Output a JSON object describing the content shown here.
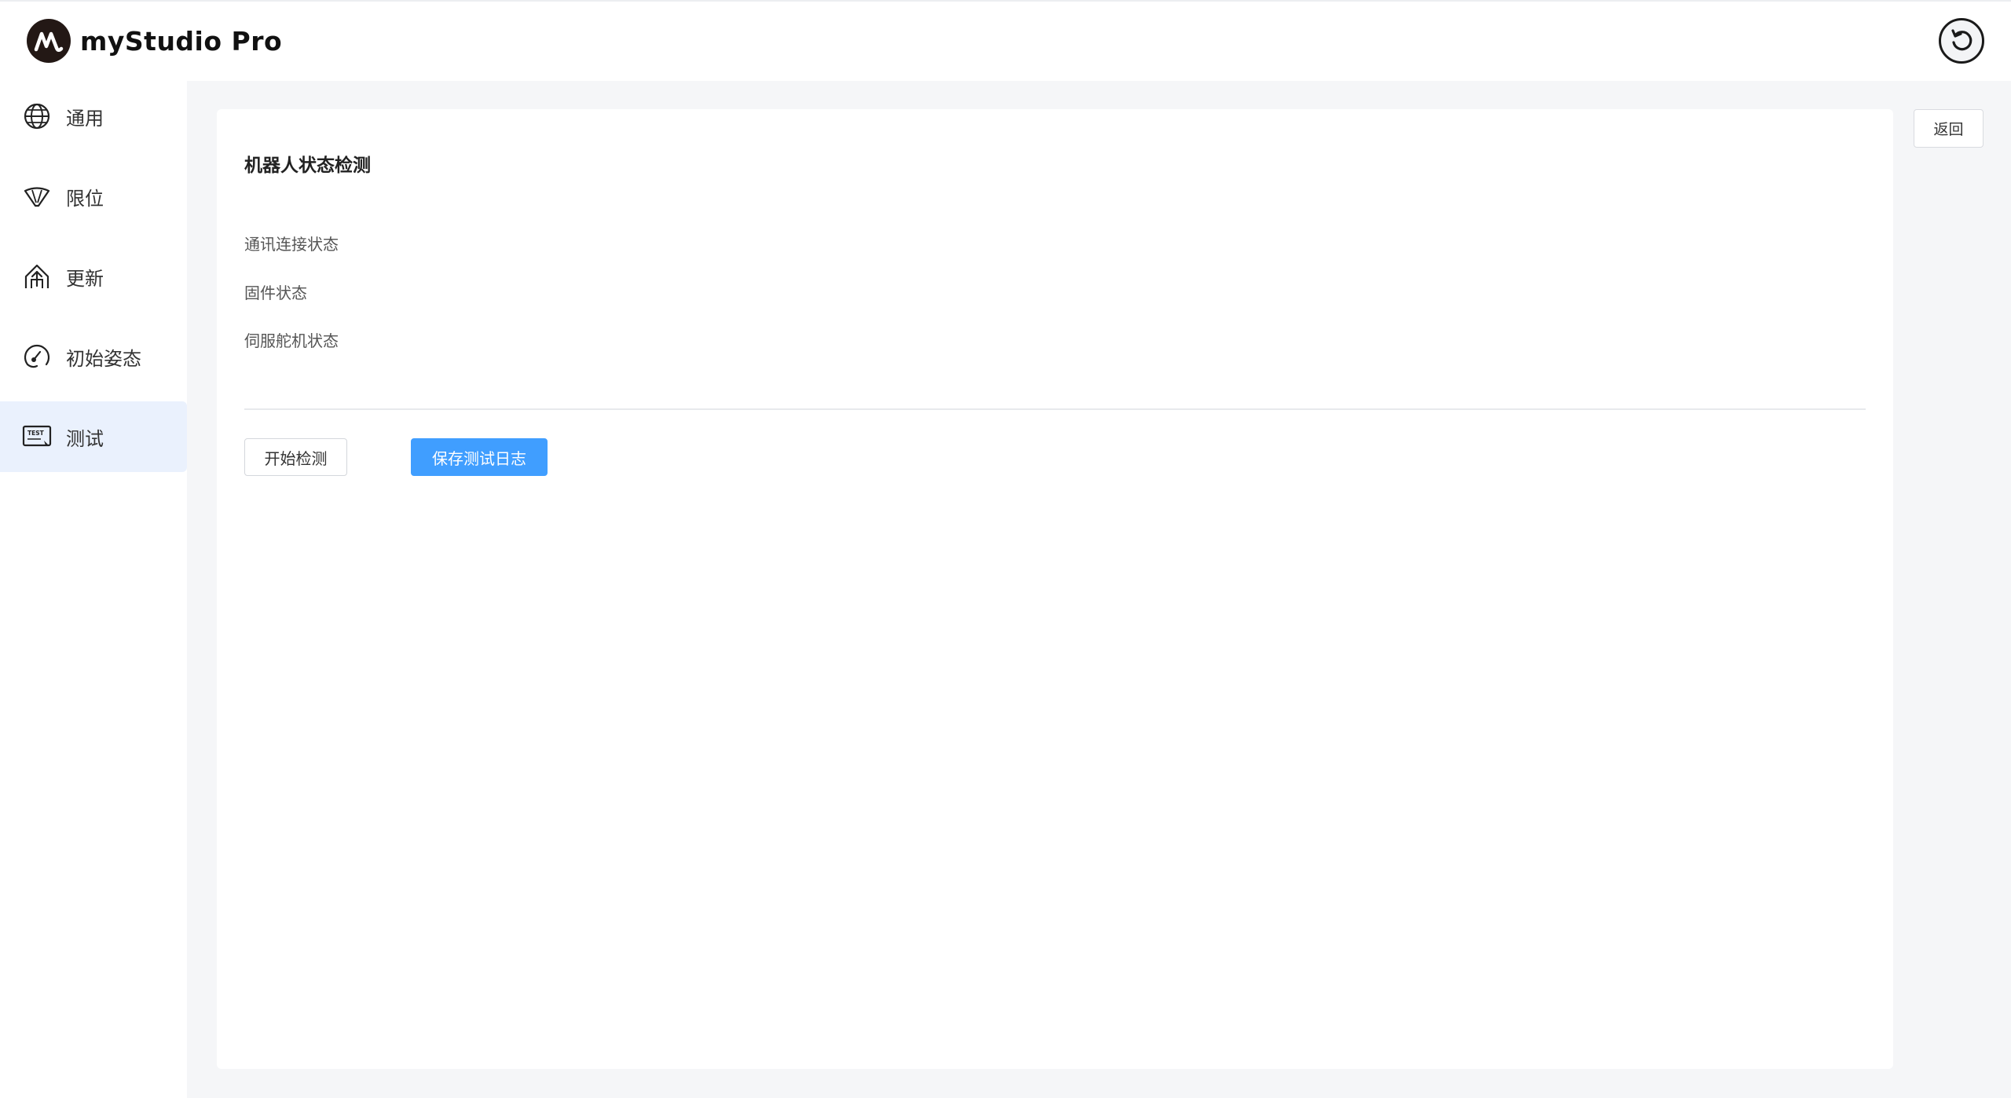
{
  "app": {
    "name": "myStudio Pro",
    "logo_icon": "mystudio-logo-icon",
    "reset_icon": "rotate-ccw-icon"
  },
  "sidebar": {
    "items": [
      {
        "label": "通用",
        "icon": "globe-icon",
        "active": false
      },
      {
        "label": "限位",
        "icon": "limit-icon",
        "active": false
      },
      {
        "label": "更新",
        "icon": "upload-icon",
        "active": false
      },
      {
        "label": "初始姿态",
        "icon": "pose-icon",
        "active": false
      },
      {
        "label": "测试",
        "icon": "test-icon",
        "active": true,
        "icon_text": "TEST"
      }
    ]
  },
  "main": {
    "back_label": "返回",
    "section_title": "机器人状态检测",
    "status_items": [
      "通讯连接状态",
      "固件状态",
      "伺服舵机状态"
    ],
    "start_button": "开始检测",
    "save_button": "保存测试日志"
  },
  "colors": {
    "primary": "#409eff",
    "active_nav_bg": "#eaf1fd",
    "main_bg": "#f5f6f8"
  }
}
